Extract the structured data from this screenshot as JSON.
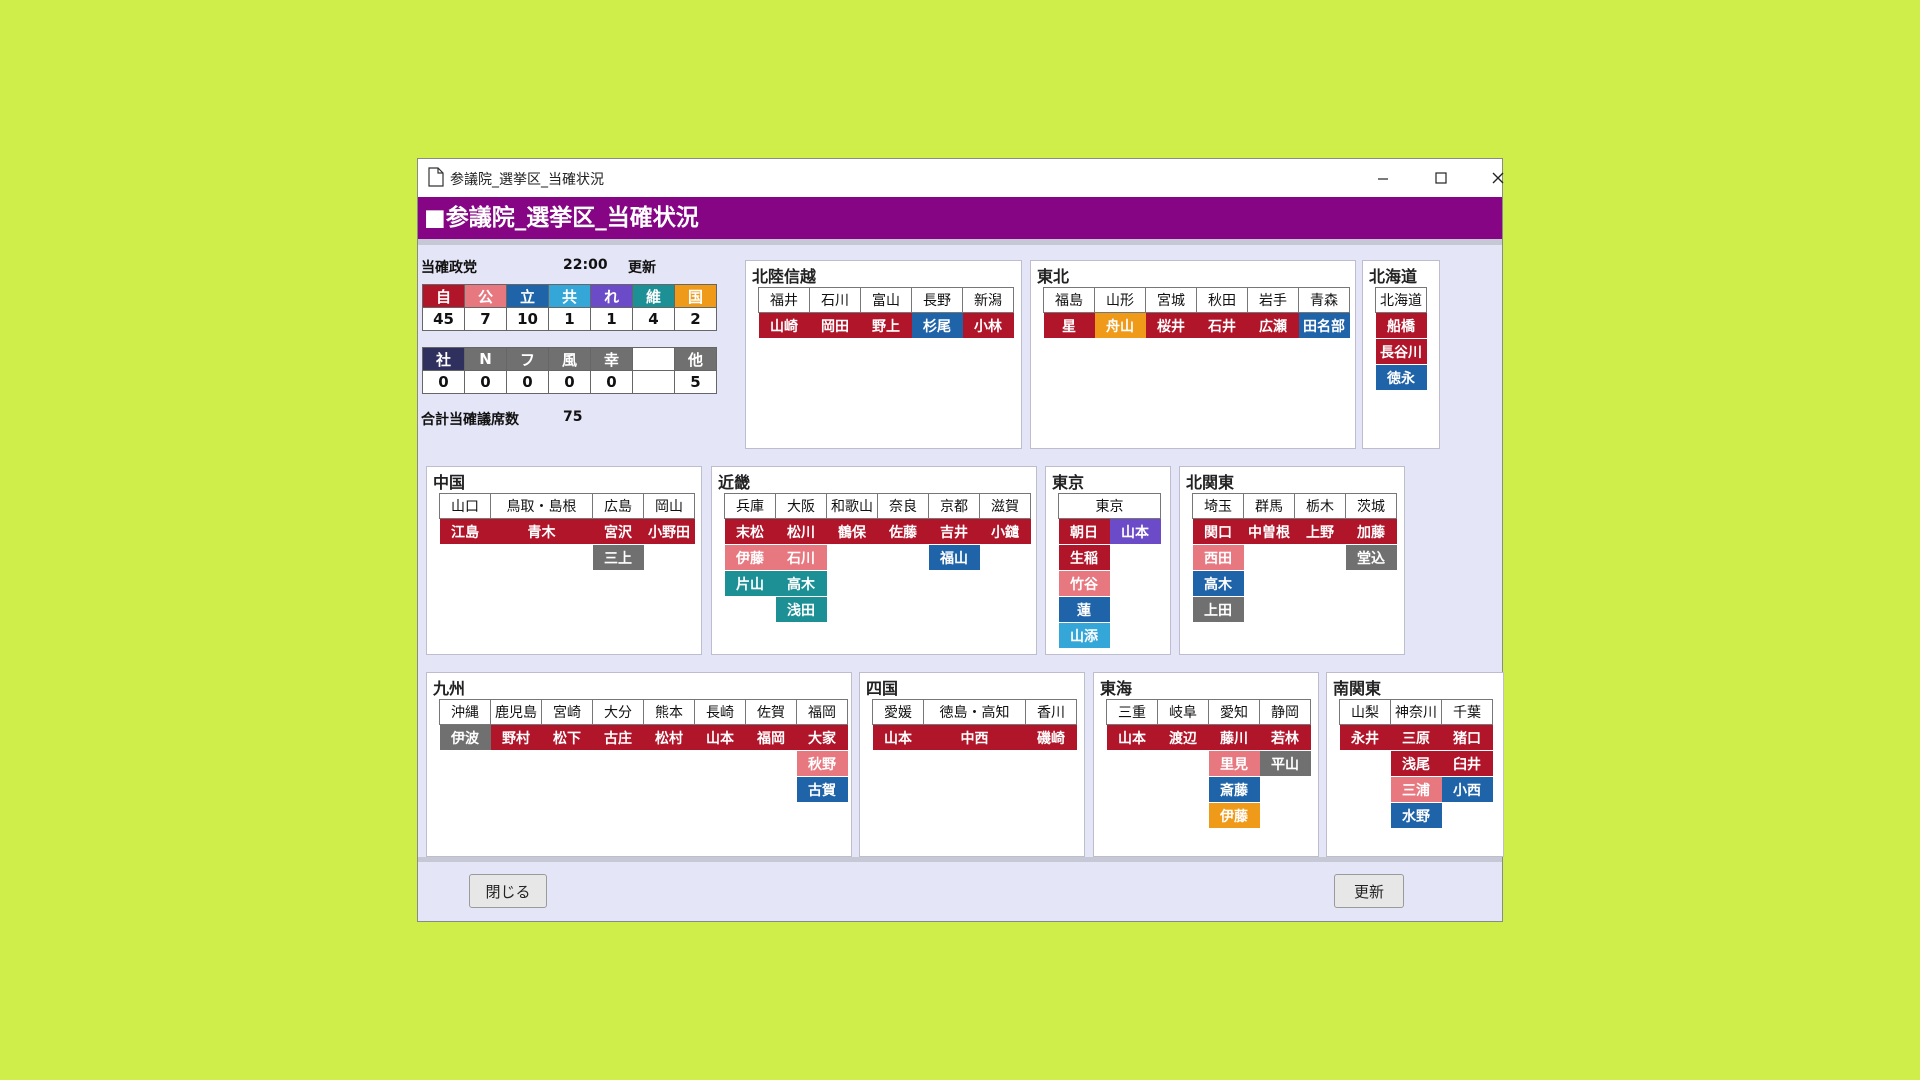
{
  "window": {
    "title": "参議院_選挙区_当確状況",
    "header": "■参議院_選挙区_当確状況"
  },
  "summary": {
    "label": "当確政党",
    "time": "22:00",
    "update_label": "更新",
    "row1": [
      {
        "name": "自",
        "value": "45",
        "color": "#b0152a"
      },
      {
        "name": "公",
        "value": "7",
        "color": "#e87880"
      },
      {
        "name": "立",
        "value": "10",
        "color": "#1f63a8"
      },
      {
        "name": "共",
        "value": "1",
        "color": "#34a6d8"
      },
      {
        "name": "れ",
        "value": "1",
        "color": "#6c4bc8"
      },
      {
        "name": "維",
        "value": "4",
        "color": "#1d9095"
      },
      {
        "name": "国",
        "value": "2",
        "color": "#ef9a18"
      }
    ],
    "row2": [
      {
        "name": "社",
        "value": "0",
        "color": "#30305f"
      },
      {
        "name": "N",
        "value": "0",
        "color": "#707070"
      },
      {
        "name": "フ",
        "value": "0",
        "color": "#707070"
      },
      {
        "name": "風",
        "value": "0",
        "color": "#707070"
      },
      {
        "name": "幸",
        "value": "0",
        "color": "#707070"
      },
      {
        "name": "",
        "value": "",
        "color": "#ffffff"
      },
      {
        "name": "他",
        "value": "5",
        "color": "#707070"
      }
    ],
    "total_label": "合計当確議席数",
    "total_value": "75"
  },
  "regions": [
    {
      "name": "北陸信越",
      "cols": [
        {
          "p": "福井",
          "c": [
            {
              "n": "山崎",
              "k": "j"
            }
          ]
        },
        {
          "p": "石川",
          "c": [
            {
              "n": "岡田",
              "k": "j"
            }
          ]
        },
        {
          "p": "富山",
          "c": [
            {
              "n": "野上",
              "k": "j"
            }
          ]
        },
        {
          "p": "長野",
          "c": [
            {
              "n": "杉尾",
              "k": "r"
            }
          ]
        },
        {
          "p": "新潟",
          "c": [
            {
              "n": "小林",
              "k": "j"
            }
          ]
        }
      ]
    },
    {
      "name": "東北",
      "cols": [
        {
          "p": "福島",
          "c": [
            {
              "n": "星",
              "k": "j"
            }
          ]
        },
        {
          "p": "山形",
          "c": [
            {
              "n": "舟山",
              "k": "k"
            }
          ]
        },
        {
          "p": "宮城",
          "c": [
            {
              "n": "桜井",
              "k": "j"
            }
          ]
        },
        {
          "p": "秋田",
          "c": [
            {
              "n": "石井",
              "k": "j"
            }
          ]
        },
        {
          "p": "岩手",
          "c": [
            {
              "n": "広瀬",
              "k": "j"
            }
          ]
        },
        {
          "p": "青森",
          "c": [
            {
              "n": "田名部",
              "k": "r"
            }
          ]
        }
      ]
    },
    {
      "name": "北海道",
      "cols": [
        {
          "p": "北海道",
          "c": [
            {
              "n": "船橋",
              "k": "j"
            },
            {
              "n": "長谷川",
              "k": "j"
            },
            {
              "n": "徳永",
              "k": "r"
            }
          ]
        }
      ]
    },
    {
      "name": "中国",
      "cols": [
        {
          "p": "山口",
          "c": [
            {
              "n": "江島",
              "k": "j"
            }
          ]
        },
        {
          "p": "鳥取・島根",
          "c": [
            {
              "n": "青木",
              "k": "j"
            }
          ]
        },
        {
          "p": "広島",
          "c": [
            {
              "n": "宮沢",
              "k": "j"
            },
            {
              "n": "三上",
              "k": "o"
            }
          ]
        },
        {
          "p": "岡山",
          "c": [
            {
              "n": "小野田",
              "k": "j"
            }
          ]
        }
      ]
    },
    {
      "name": "近畿",
      "cols": [
        {
          "p": "兵庫",
          "c": [
            {
              "n": "末松",
              "k": "j"
            },
            {
              "n": "伊藤",
              "k": "m"
            },
            {
              "n": "片山",
              "k": "i"
            }
          ]
        },
        {
          "p": "大阪",
          "c": [
            {
              "n": "松川",
              "k": "j"
            },
            {
              "n": "石川",
              "k": "m"
            },
            {
              "n": "高木",
              "k": "i"
            },
            {
              "n": "浅田",
              "k": "i"
            }
          ]
        },
        {
          "p": "和歌山",
          "c": [
            {
              "n": "鶴保",
              "k": "j"
            }
          ]
        },
        {
          "p": "奈良",
          "c": [
            {
              "n": "佐藤",
              "k": "j"
            }
          ]
        },
        {
          "p": "京都",
          "c": [
            {
              "n": "吉井",
              "k": "j"
            },
            {
              "n": "福山",
              "k": "r"
            }
          ]
        },
        {
          "p": "滋賀",
          "c": [
            {
              "n": "小鑓",
              "k": "j"
            }
          ]
        }
      ]
    },
    {
      "name": "東京",
      "cols": [
        {
          "p": "東京",
          "c": [
            {
              "n": "朝日",
              "k": "j"
            },
            {
              "n": "生稲",
              "k": "j"
            },
            {
              "n": "竹谷",
              "k": "m"
            },
            {
              "n": "蓮",
              "k": "r"
            },
            {
              "n": "山添",
              "k": "c"
            }
          ]
        },
        {
          "p": "",
          "c": [
            {
              "n": "山本",
              "k": "w"
            }
          ]
        }
      ]
    },
    {
      "name": "北関東",
      "cols": [
        {
          "p": "埼玉",
          "c": [
            {
              "n": "関口",
              "k": "j"
            },
            {
              "n": "西田",
              "k": "m"
            },
            {
              "n": "高木",
              "k": "r"
            },
            {
              "n": "上田",
              "k": "o"
            }
          ]
        },
        {
          "p": "群馬",
          "c": [
            {
              "n": "中曽根",
              "k": "j"
            }
          ]
        },
        {
          "p": "栃木",
          "c": [
            {
              "n": "上野",
              "k": "j"
            }
          ]
        },
        {
          "p": "茨城",
          "c": [
            {
              "n": "加藤",
              "k": "j"
            },
            {
              "n": "堂込",
              "k": "o"
            }
          ]
        }
      ]
    },
    {
      "name": "九州",
      "cols": [
        {
          "p": "沖縄",
          "c": [
            {
              "n": "伊波",
              "k": "o"
            }
          ]
        },
        {
          "p": "鹿児島",
          "c": [
            {
              "n": "野村",
              "k": "j"
            }
          ]
        },
        {
          "p": "宮崎",
          "c": [
            {
              "n": "松下",
              "k": "j"
            }
          ]
        },
        {
          "p": "大分",
          "c": [
            {
              "n": "古庄",
              "k": "j"
            }
          ]
        },
        {
          "p": "熊本",
          "c": [
            {
              "n": "松村",
              "k": "j"
            }
          ]
        },
        {
          "p": "長崎",
          "c": [
            {
              "n": "山本",
              "k": "j"
            }
          ]
        },
        {
          "p": "佐賀",
          "c": [
            {
              "n": "福岡",
              "k": "j"
            }
          ]
        },
        {
          "p": "福岡",
          "c": [
            {
              "n": "大家",
              "k": "j"
            },
            {
              "n": "秋野",
              "k": "m"
            },
            {
              "n": "古賀",
              "k": "r"
            }
          ]
        }
      ]
    },
    {
      "name": "四国",
      "cols": [
        {
          "p": "愛媛",
          "c": [
            {
              "n": "山本",
              "k": "j"
            }
          ]
        },
        {
          "p": "徳島・高知",
          "c": [
            {
              "n": "中西",
              "k": "j"
            }
          ]
        },
        {
          "p": "香川",
          "c": [
            {
              "n": "磯崎",
              "k": "j"
            }
          ]
        }
      ]
    },
    {
      "name": "東海",
      "cols": [
        {
          "p": "三重",
          "c": [
            {
              "n": "山本",
              "k": "j"
            }
          ]
        },
        {
          "p": "岐阜",
          "c": [
            {
              "n": "渡辺",
              "k": "j"
            }
          ]
        },
        {
          "p": "愛知",
          "c": [
            {
              "n": "藤川",
              "k": "j"
            },
            {
              "n": "里見",
              "k": "m"
            },
            {
              "n": "斎藤",
              "k": "r"
            },
            {
              "n": "伊藤",
              "k": "k"
            }
          ]
        },
        {
          "p": "静岡",
          "c": [
            {
              "n": "若林",
              "k": "j"
            },
            {
              "n": "平山",
              "k": "o"
            }
          ]
        }
      ]
    },
    {
      "name": "南関東",
      "cols": [
        {
          "p": "山梨",
          "c": [
            {
              "n": "永井",
              "k": "j"
            }
          ]
        },
        {
          "p": "神奈川",
          "c": [
            {
              "n": "三原",
              "k": "j"
            },
            {
              "n": "浅尾",
              "k": "j"
            },
            {
              "n": "三浦",
              "k": "m"
            },
            {
              "n": "水野",
              "k": "r"
            }
          ]
        },
        {
          "p": "千葉",
          "c": [
            {
              "n": "猪口",
              "k": "j"
            },
            {
              "n": "臼井",
              "k": "j"
            },
            {
              "n": "小西",
              "k": "r"
            }
          ]
        }
      ]
    }
  ],
  "party_colors": {
    "j": "#b0152a",
    "m": "#e87880",
    "r": "#1f63a8",
    "c": "#34a6d8",
    "w": "#6c4bc8",
    "i": "#1d9095",
    "k": "#ef9a18",
    "o": "#707070"
  },
  "buttons": {
    "close": "閉じる",
    "update": "更新"
  }
}
